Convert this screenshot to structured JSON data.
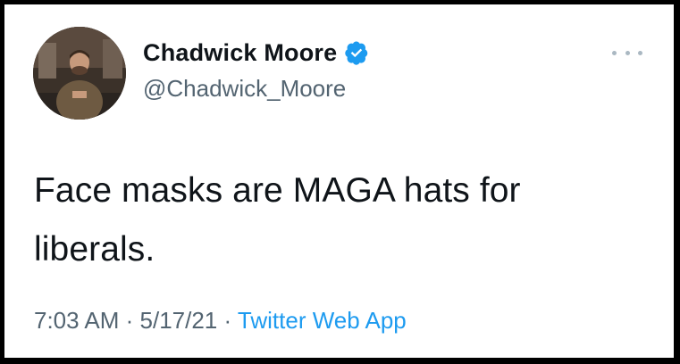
{
  "author": {
    "display_name": "Chadwick Moore",
    "handle": "@Chadwick_Moore",
    "verified": true,
    "verified_icon": "verified-badge-icon",
    "verified_color": "#1d9bf0"
  },
  "more_menu": {
    "icon": "more-options-icon"
  },
  "tweet": {
    "text": "Face masks are MAGA hats for liberals."
  },
  "meta": {
    "time": "7:03 AM",
    "separator_1": " · ",
    "date": "5/17/21",
    "separator_2": " · ",
    "source": "Twitter Web App",
    "source_color": "#1d9bf0"
  }
}
